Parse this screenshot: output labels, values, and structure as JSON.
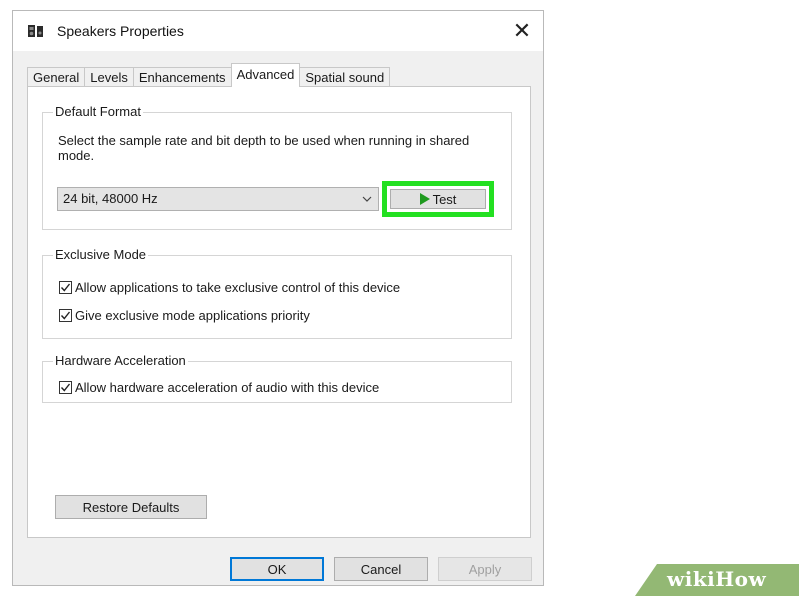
{
  "window": {
    "title": "Speakers Properties",
    "title_icon": "speaker-icon",
    "close_glyph": "✕"
  },
  "tabs": [
    {
      "label": "General",
      "active": false
    },
    {
      "label": "Levels",
      "active": false
    },
    {
      "label": "Enhancements",
      "active": false
    },
    {
      "label": "Advanced",
      "active": true
    },
    {
      "label": "Spatial sound",
      "active": false
    }
  ],
  "default_format": {
    "label": "Default Format",
    "description": "Select the sample rate and bit depth to be used when running in shared mode.",
    "selected_value": "24 bit, 48000 Hz",
    "test_label": "Test",
    "highlight_color": "#23e021"
  },
  "exclusive_mode": {
    "label": "Exclusive Mode",
    "options": [
      {
        "label": "Allow applications to take exclusive control of this device",
        "checked": true
      },
      {
        "label": "Give exclusive mode applications priority",
        "checked": true
      }
    ]
  },
  "hardware_acceleration": {
    "label": "Hardware Acceleration",
    "options": [
      {
        "label": "Allow hardware acceleration of audio with this device",
        "checked": true
      }
    ]
  },
  "buttons": {
    "restore_defaults": "Restore Defaults",
    "ok": "OK",
    "cancel": "Cancel",
    "apply": "Apply"
  },
  "watermark": {
    "wiki": "wiki",
    "how": "How"
  }
}
